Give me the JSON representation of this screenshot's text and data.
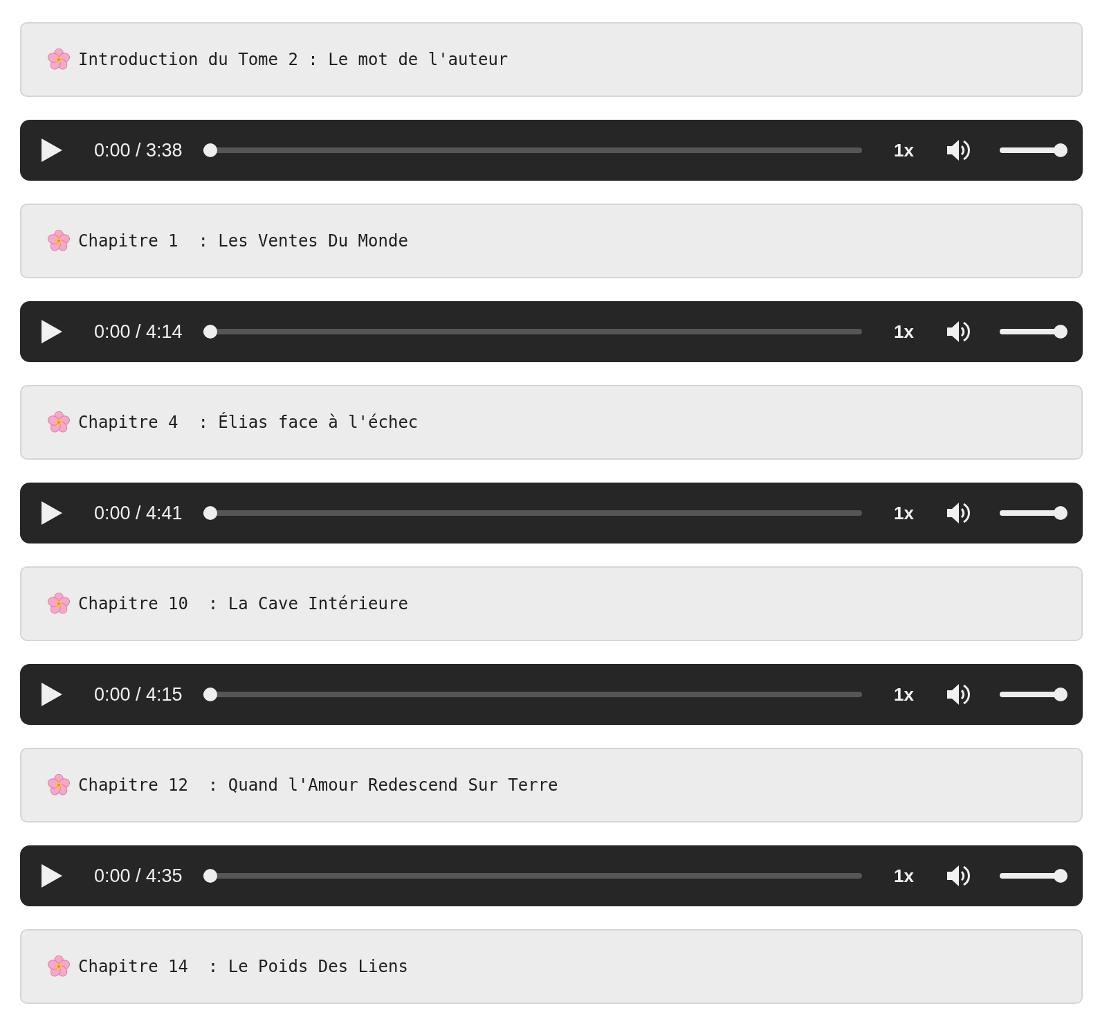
{
  "items": [
    {
      "kind": "title",
      "text": "Introduction du Tome 2 : Le mot de l'auteur"
    },
    {
      "kind": "player",
      "time": "0:00 / 3:38",
      "speed": "1x",
      "progress": {
        "level": 0
      },
      "volume": {
        "level": 1
      }
    },
    {
      "kind": "title",
      "text": "Chapitre 1  : Les Ventes Du Monde"
    },
    {
      "kind": "player",
      "time": "0:00 / 4:14",
      "speed": "1x",
      "progress": {
        "level": 0
      },
      "volume": {
        "level": 1
      }
    },
    {
      "kind": "title",
      "text": "Chapitre 4  : Élias face à l'échec"
    },
    {
      "kind": "player",
      "time": "0:00 / 4:41",
      "speed": "1x",
      "progress": {
        "level": 0
      },
      "volume": {
        "level": 1
      }
    },
    {
      "kind": "title",
      "text": "Chapitre 10  : La Cave Intérieure"
    },
    {
      "kind": "player",
      "time": "0:00 / 4:15",
      "speed": "1x",
      "progress": {
        "level": 0
      },
      "volume": {
        "level": 1
      }
    },
    {
      "kind": "title",
      "text": "Chapitre 12  : Quand l'Amour Redescend Sur Terre"
    },
    {
      "kind": "player",
      "time": "0:00 / 4:35",
      "speed": "1x",
      "progress": {
        "level": 0
      },
      "volume": {
        "level": 1
      }
    },
    {
      "kind": "title",
      "text": "Chapitre 14  : Le Poids Des Liens"
    }
  ]
}
